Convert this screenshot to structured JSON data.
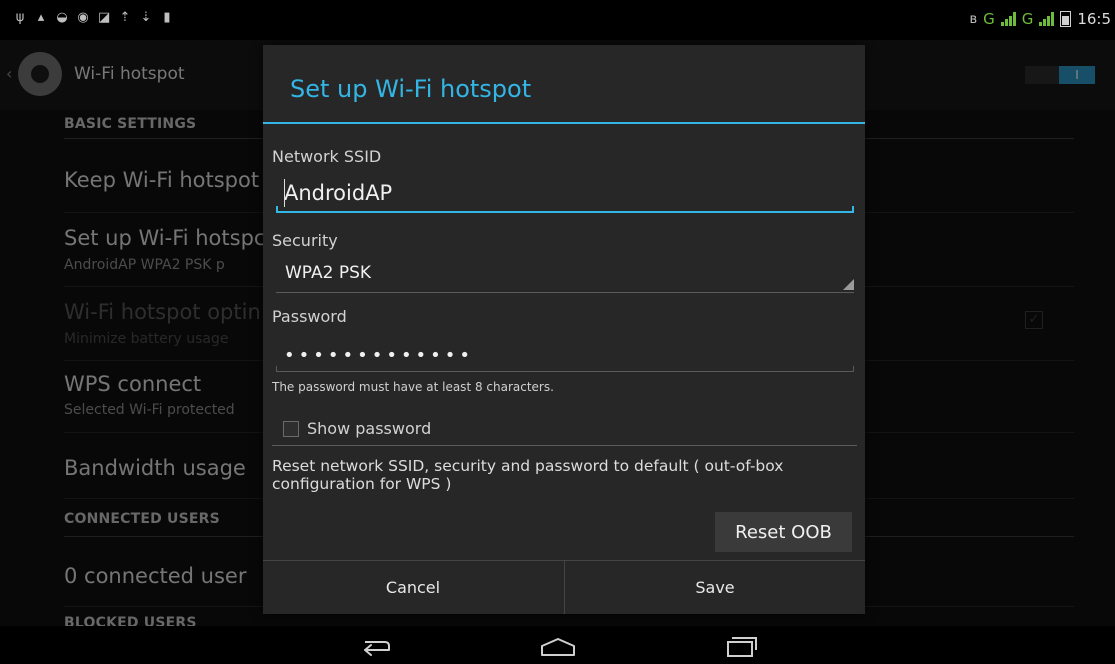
{
  "status_bar": {
    "left_icons": [
      "usb-icon",
      "lock-icon",
      "wifi-hotspot-icon",
      "sync-icon",
      "image-icon",
      "upload-icon",
      "download-icon",
      "sd-card-icon"
    ],
    "network_letter_1": "G",
    "network_letter_2": "G",
    "time": "16:5",
    "accent_signal": "#6dbd3b"
  },
  "action_bar": {
    "title": "Wi-Fi hotspot",
    "toggle_label": "I"
  },
  "settings": {
    "basic_section": "BASIC SETTINGS",
    "items": [
      {
        "title": "Keep Wi-Fi hotspot",
        "subtitle": ""
      },
      {
        "title": "Set up Wi-Fi hotspc",
        "subtitle": "AndroidAP WPA2 PSK p"
      },
      {
        "title": "Wi-Fi hotspot optin",
        "subtitle": "Minimize battery usage"
      },
      {
        "title": "WPS connect",
        "subtitle": "Selected Wi-Fi protected"
      },
      {
        "title": "Bandwidth usage",
        "subtitle": ""
      }
    ],
    "connected_section": "CONNECTED USERS",
    "connected_count": "0 connected user",
    "blocked_section": "BLOCKED USERS"
  },
  "dialog": {
    "title": "Set up Wi-Fi hotspot",
    "accent": "#33b5e5",
    "ssid_label": "Network SSID",
    "ssid_value": "AndroidAP",
    "security_label": "Security",
    "security_value": "WPA2 PSK",
    "password_label": "Password",
    "password_value": "•••••••••••••",
    "password_hint": "The password must have at least 8 characters.",
    "show_password_label": "Show password",
    "show_password_checked": false,
    "reset_text": "Reset network SSID, security and password to default ( out-of-box configuration for WPS )",
    "reset_button": "Reset OOB",
    "cancel_button": "Cancel",
    "save_button": "Save"
  },
  "nav_bar": {
    "icons": [
      "back-icon",
      "home-icon",
      "recent-apps-icon"
    ]
  }
}
